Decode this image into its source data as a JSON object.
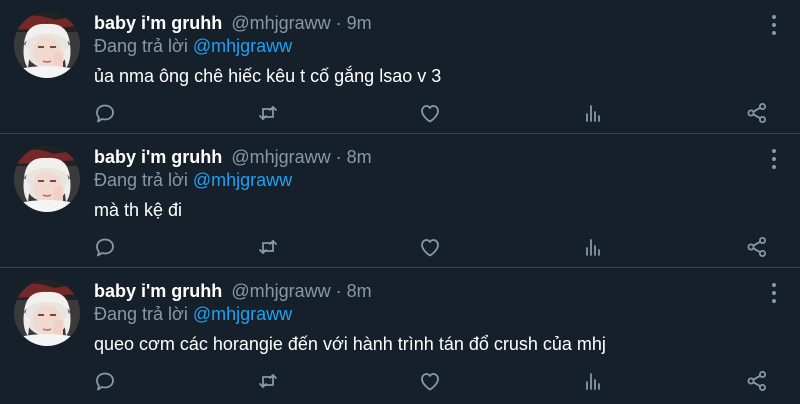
{
  "colors": {
    "background": "#15202b",
    "text": "#ffffff",
    "muted": "#8899a6",
    "link": "#1da1f2",
    "divider": "#38444d"
  },
  "tweets": [
    {
      "name": "baby i'm gruhh",
      "handle": "@mhjgraww",
      "separator": "·",
      "time": "9m",
      "reply_prefix": "Đang trả lời ",
      "reply_to": "@mhjgraww",
      "text": "ủa nma ông chê hiếc kêu t cố gắng lsao v 3"
    },
    {
      "name": "baby i'm gruhh",
      "handle": "@mhjgraww",
      "separator": "·",
      "time": "8m",
      "reply_prefix": "Đang trả lời ",
      "reply_to": "@mhjgraww",
      "text": "mà th kệ đi"
    },
    {
      "name": "baby i'm gruhh",
      "handle": "@mhjgraww",
      "separator": "·",
      "time": "8m",
      "reply_prefix": "Đang trả lời ",
      "reply_to": "@mhjgraww",
      "text": "queo cơm các horangie đến với hành trình tán đổ crush của mhj"
    }
  ],
  "icons": {
    "reply": "reply-icon",
    "retweet": "retweet-icon",
    "like": "heart-icon",
    "stats": "stats-icon",
    "share": "share-icon",
    "more": "more-vertical-icon"
  }
}
